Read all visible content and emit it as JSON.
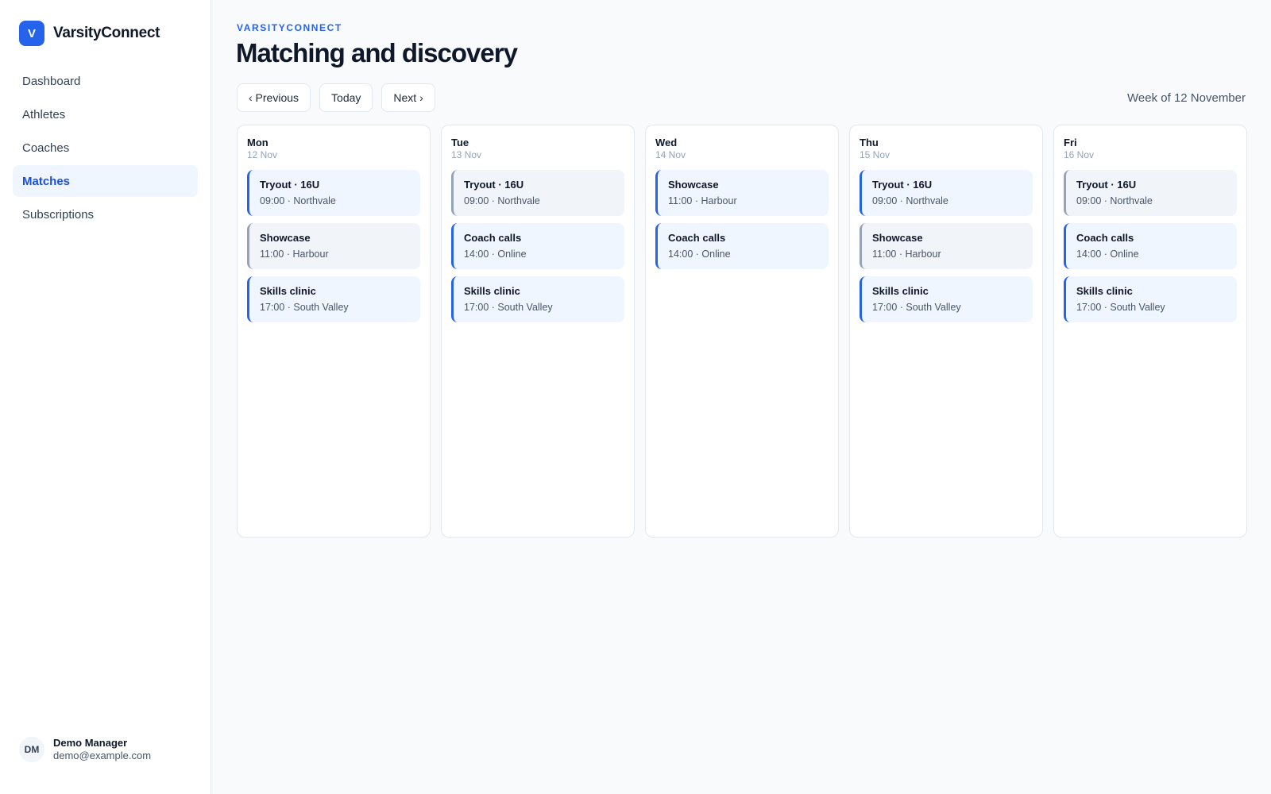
{
  "app": {
    "logo_letter": "V",
    "name": "VarsityConnect",
    "accent_color": "#2563eb"
  },
  "sidebar": {
    "items": [
      {
        "label": "Dashboard",
        "active": false
      },
      {
        "label": "Athletes",
        "active": false
      },
      {
        "label": "Coaches",
        "active": false
      },
      {
        "label": "Matches",
        "active": true
      },
      {
        "label": "Subscriptions",
        "active": false
      }
    ]
  },
  "user": {
    "initials": "DM",
    "name": "Demo Manager",
    "email": "demo@example.com"
  },
  "header": {
    "eyebrow": "VARSITYCONNECT",
    "title": "Matching and discovery"
  },
  "toolbar": {
    "previous_label": "‹ Previous",
    "today_label": "Today",
    "next_label": "Next ›",
    "week_label": "Week of 12 November"
  },
  "days": [
    {
      "name": "Mon",
      "date": "12 Nov",
      "events": [
        {
          "title": "Tryout · 16U",
          "meta": "09:00 · Northvale",
          "muted": false
        },
        {
          "title": "Showcase",
          "meta": "11:00 · Harbour",
          "muted": true
        },
        {
          "title": "Skills clinic",
          "meta": "17:00 · South Valley",
          "muted": false
        }
      ]
    },
    {
      "name": "Tue",
      "date": "13 Nov",
      "events": [
        {
          "title": "Tryout · 16U",
          "meta": "09:00 · Northvale",
          "muted": true
        },
        {
          "title": "Coach calls",
          "meta": "14:00 · Online",
          "muted": false
        },
        {
          "title": "Skills clinic",
          "meta": "17:00 · South Valley",
          "muted": false
        }
      ]
    },
    {
      "name": "Wed",
      "date": "14 Nov",
      "events": [
        {
          "title": "Showcase",
          "meta": "11:00 · Harbour",
          "muted": false
        },
        {
          "title": "Coach calls",
          "meta": "14:00 · Online",
          "muted": false
        }
      ]
    },
    {
      "name": "Thu",
      "date": "15 Nov",
      "events": [
        {
          "title": "Tryout · 16U",
          "meta": "09:00 · Northvale",
          "muted": false
        },
        {
          "title": "Showcase",
          "meta": "11:00 · Harbour",
          "muted": true
        },
        {
          "title": "Skills clinic",
          "meta": "17:00 · South Valley",
          "muted": false
        }
      ]
    },
    {
      "name": "Fri",
      "date": "16 Nov",
      "events": [
        {
          "title": "Tryout · 16U",
          "meta": "09:00 · Northvale",
          "muted": true
        },
        {
          "title": "Coach calls",
          "meta": "14:00 · Online",
          "muted": false
        },
        {
          "title": "Skills clinic",
          "meta": "17:00 · South Valley",
          "muted": false
        }
      ]
    }
  ]
}
